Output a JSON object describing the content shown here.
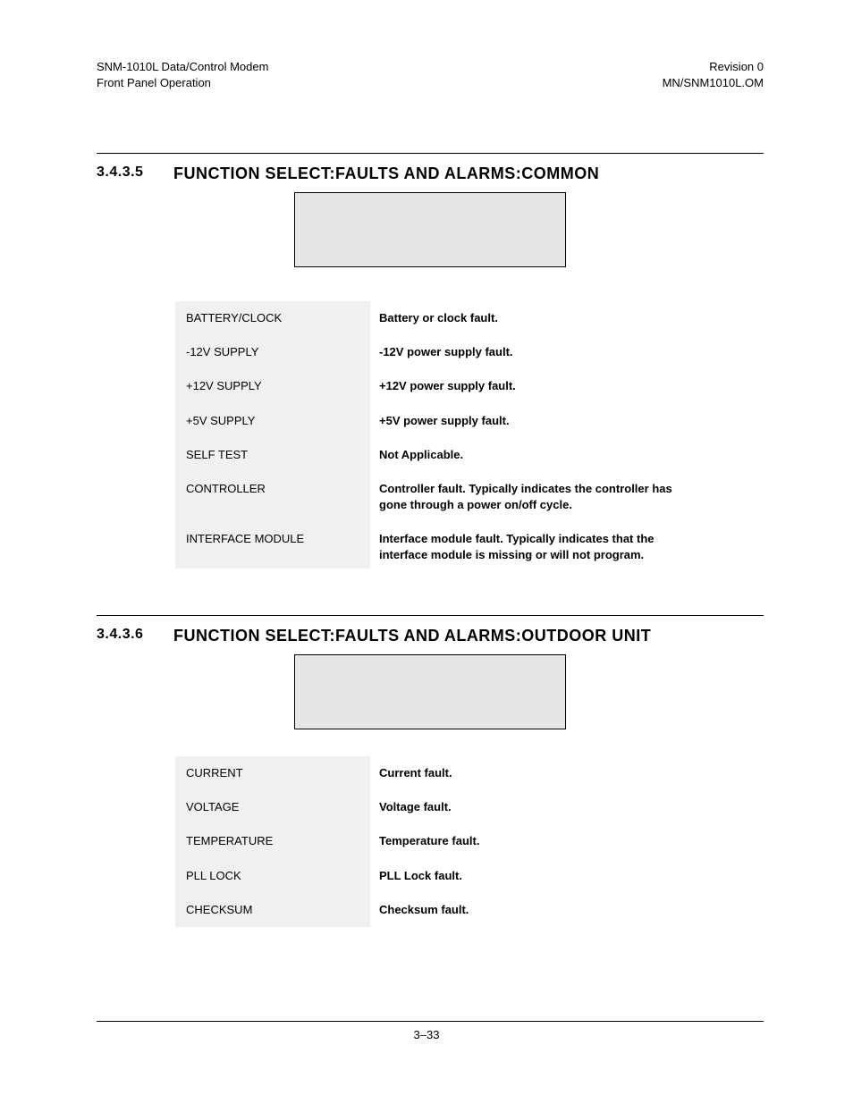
{
  "header": {
    "leftLine1": "SNM-1010L Data/Control Modem",
    "leftLine2": "Front Panel Operation",
    "rightLine1": "Revision 0",
    "rightLine2": "MN/SNM1010L.OM"
  },
  "sections": [
    {
      "number": "3.4.3.5",
      "title": "FUNCTION SELECT:FAULTS AND ALARMS:COMMON",
      "rows": [
        {
          "label": "BATTERY/CLOCK",
          "desc": "Battery or clock fault."
        },
        {
          "label": "-12V SUPPLY",
          "desc": "-12V power supply fault."
        },
        {
          "label": "+12V SUPPLY",
          "desc": "+12V power supply fault."
        },
        {
          "label": "+5V SUPPLY",
          "desc": "+5V power supply fault."
        },
        {
          "label": "SELF TEST",
          "desc": "Not Applicable."
        },
        {
          "label": "CONTROLLER",
          "desc": "Controller fault. Typically indicates the controller has gone through a power on/off cycle."
        },
        {
          "label": "INTERFACE MODULE",
          "desc": "Interface module fault. Typically indicates that the interface module is missing or will not program."
        }
      ]
    },
    {
      "number": "3.4.3.6",
      "title": "FUNCTION SELECT:FAULTS AND ALARMS:OUTDOOR UNIT",
      "rows": [
        {
          "label": "CURRENT",
          "desc": "Current fault."
        },
        {
          "label": "VOLTAGE",
          "desc": "Voltage fault."
        },
        {
          "label": "TEMPERATURE",
          "desc": "Temperature fault."
        },
        {
          "label": "PLL LOCK",
          "desc": "PLL Lock fault."
        },
        {
          "label": "CHECKSUM",
          "desc": "Checksum fault."
        }
      ]
    }
  ],
  "pageNumber": "3–33"
}
